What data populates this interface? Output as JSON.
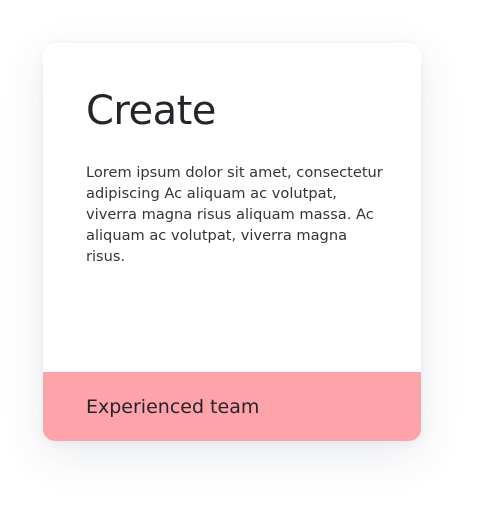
{
  "card": {
    "title": "Create",
    "description": "Lorem ipsum dolor sit amet, consectetur adipiscing Ac aliquam ac volutpat, viverra magna risus aliquam massa. Ac aliquam ac volutpat, viverra magna risus.",
    "footer_label": "Experienced team"
  },
  "colors": {
    "footer_background": "#ffa3aa",
    "card_background": "#ffffff",
    "text": "#24242a"
  }
}
